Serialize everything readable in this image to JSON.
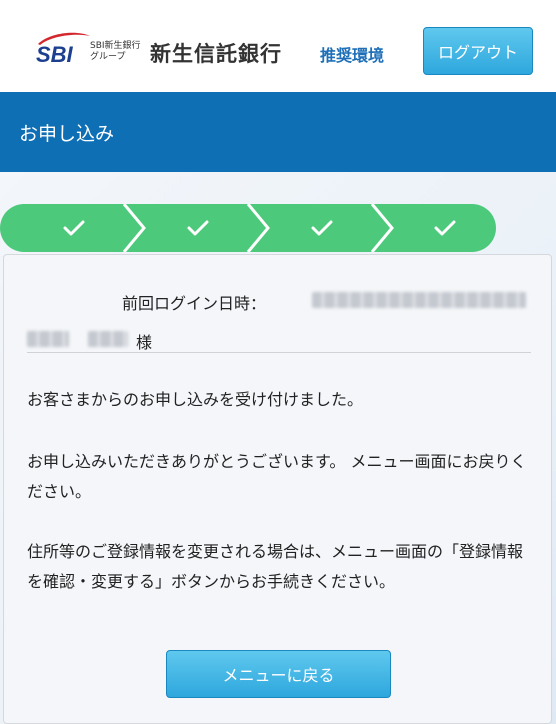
{
  "header": {
    "logo_text": "SBI",
    "logo_sub_line1": "SBI新生銀行",
    "logo_sub_line2": "グループ",
    "bank_name": "新生信託銀行",
    "recommend_label": "推奨環境",
    "logout_label": "ログアウト"
  },
  "title_bar": {
    "title": "お申し込み"
  },
  "progress": {
    "steps_completed": 4,
    "steps_total": 4,
    "step_color": "#4cc97a"
  },
  "card": {
    "login_label": "前回ログイン日時：",
    "honorific": "様",
    "messages": [
      "お客さまからのお申し込みを受け付けました。",
      "お申し込みいただきありがとうございます。 メニュー画面にお戻りください。",
      "住所等のご登録情報を変更される場合は、メニュー画面の「登録情報を確認・変更する」ボタンからお手続きください。"
    ],
    "menu_button_label": "メニューに戻る"
  },
  "colors": {
    "brand_blue": "#0f6fb5",
    "button_blue": "#2ea7dd",
    "logo_red": "#d2282e"
  }
}
